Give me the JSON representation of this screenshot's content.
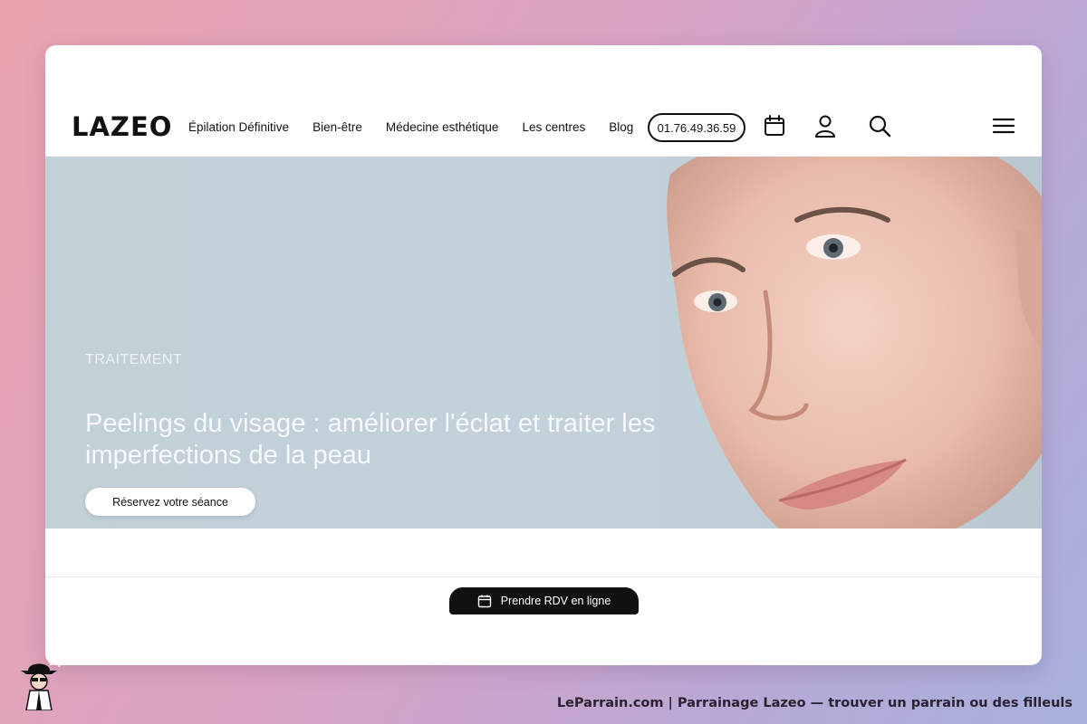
{
  "header": {
    "logo": "LAZEO",
    "nav": [
      {
        "label": "Épilation Définitive"
      },
      {
        "label": "Bien-être"
      },
      {
        "label": "Médecine esthétique"
      },
      {
        "label": "Les centres"
      },
      {
        "label": "Blog"
      }
    ],
    "phone": "01.76.49.36.59",
    "icons": [
      "calendar-icon",
      "user-icon",
      "search-icon",
      "menu-icon"
    ]
  },
  "hero": {
    "kicker": "TRAITEMENT",
    "title": "Peelings du visage : améliorer l'éclat et traiter les imperfections de la peau",
    "cta": "Réservez votre séance"
  },
  "sticky": {
    "label": "Prendre RDV en ligne",
    "icon": "calendar-icon"
  },
  "footer": {
    "caption": "LeParrain.com | Parrainage Lazeo — trouver un parrain ou des filleuls",
    "mascot_icon": "detective-mascot-icon"
  },
  "colors": {
    "accent": "#111111",
    "hero_bg": "#c2d0d8",
    "page_bg_start": "#eaa4ad",
    "page_bg_end": "#a7b1dc"
  }
}
